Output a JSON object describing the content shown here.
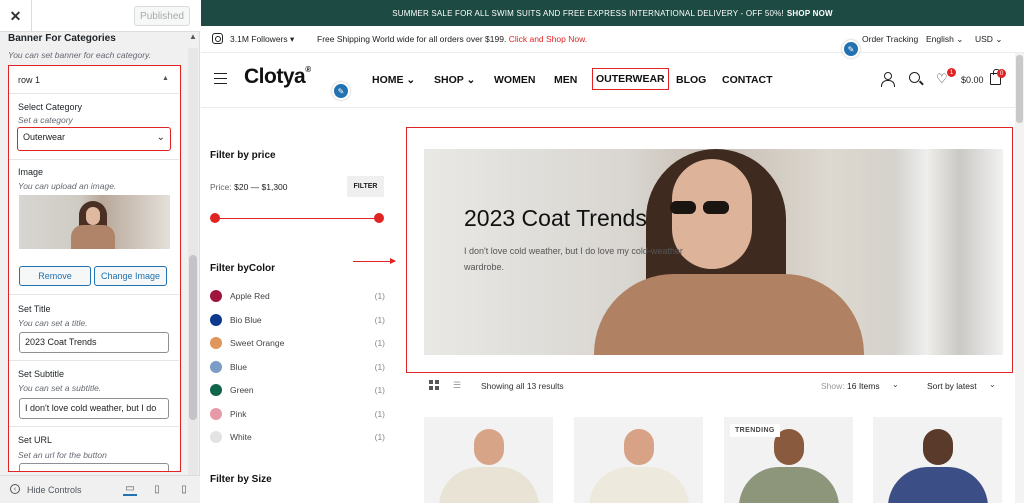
{
  "panel": {
    "publish_label": "Published",
    "section_title": "Banner For Categories",
    "section_desc": "You can set banner for each category.",
    "row_title": "row 1",
    "category": {
      "label": "Select Category",
      "hint": "Set a category",
      "value": "Outerwear"
    },
    "image": {
      "label": "Image",
      "hint": "You can upload an image.",
      "remove_label": "Remove",
      "change_label": "Change Image"
    },
    "title_field": {
      "label": "Set Title",
      "hint": "You can set a title.",
      "value": "2023 Coat Trends"
    },
    "subtitle_field": {
      "label": "Set Subtitle",
      "hint": "You can set a subtitle.",
      "value": "I don't love cold weather, but I do"
    },
    "url_field": {
      "label": "Set URL",
      "hint": "Set an url for the button",
      "value": ""
    },
    "hide_controls": "Hide Controls"
  },
  "site": {
    "announcement": {
      "text": "SUMMER SALE FOR ALL SWIM SUITS AND FREE EXPRESS INTERNATIONAL DELIVERY - OFF 50%!",
      "link": "SHOP NOW"
    },
    "utility": {
      "followers": "3.1M Followers",
      "shipping_text": "Free Shipping World wide for all orders over $199.",
      "shipping_link": "Click and Shop Now.",
      "order_tracking": "Order Tracking",
      "language": "English",
      "currency": "USD"
    },
    "logo": "Clotya",
    "logo_mark": "®",
    "nav": [
      "HOME",
      "SHOP",
      "WOMEN",
      "MEN",
      "OUTERWEAR",
      "BLOG",
      "CONTACT"
    ],
    "wishlist_count": "1",
    "cart_total": "$0.00",
    "cart_count": "0",
    "filters": {
      "price_title": "Filter by price",
      "price_label": "Price:",
      "price_range": "$20 — $1,300",
      "filter_button": "FILTER",
      "color_title": "Filter byColor",
      "colors": [
        {
          "name": "Apple Red",
          "count": "(1)",
          "hex": "#a0153e"
        },
        {
          "name": "Bio Blue",
          "count": "(1)",
          "hex": "#0d3a8c"
        },
        {
          "name": "Sweet Orange",
          "count": "(1)",
          "hex": "#e0955a"
        },
        {
          "name": "Blue",
          "count": "(1)",
          "hex": "#7a9cc6"
        },
        {
          "name": "Green",
          "count": "(1)",
          "hex": "#10644a"
        },
        {
          "name": "Pink",
          "count": "(1)",
          "hex": "#e69aa8"
        },
        {
          "name": "White",
          "count": "(1)",
          "hex": "#e3e3e3"
        }
      ],
      "size_title": "Filter by Size"
    },
    "banner": {
      "title": "2023 Coat Trends",
      "subtitle": "I don't love cold weather, but I do love my cold-weather wardrobe."
    },
    "toolbar": {
      "showing": "Showing all 13 results",
      "show_label": "Show:",
      "show_value": "16 Items",
      "sort": "Sort by latest"
    },
    "products": [
      {
        "badge": ""
      },
      {
        "badge": ""
      },
      {
        "badge": "TRENDING"
      },
      {
        "badge": ""
      }
    ]
  }
}
